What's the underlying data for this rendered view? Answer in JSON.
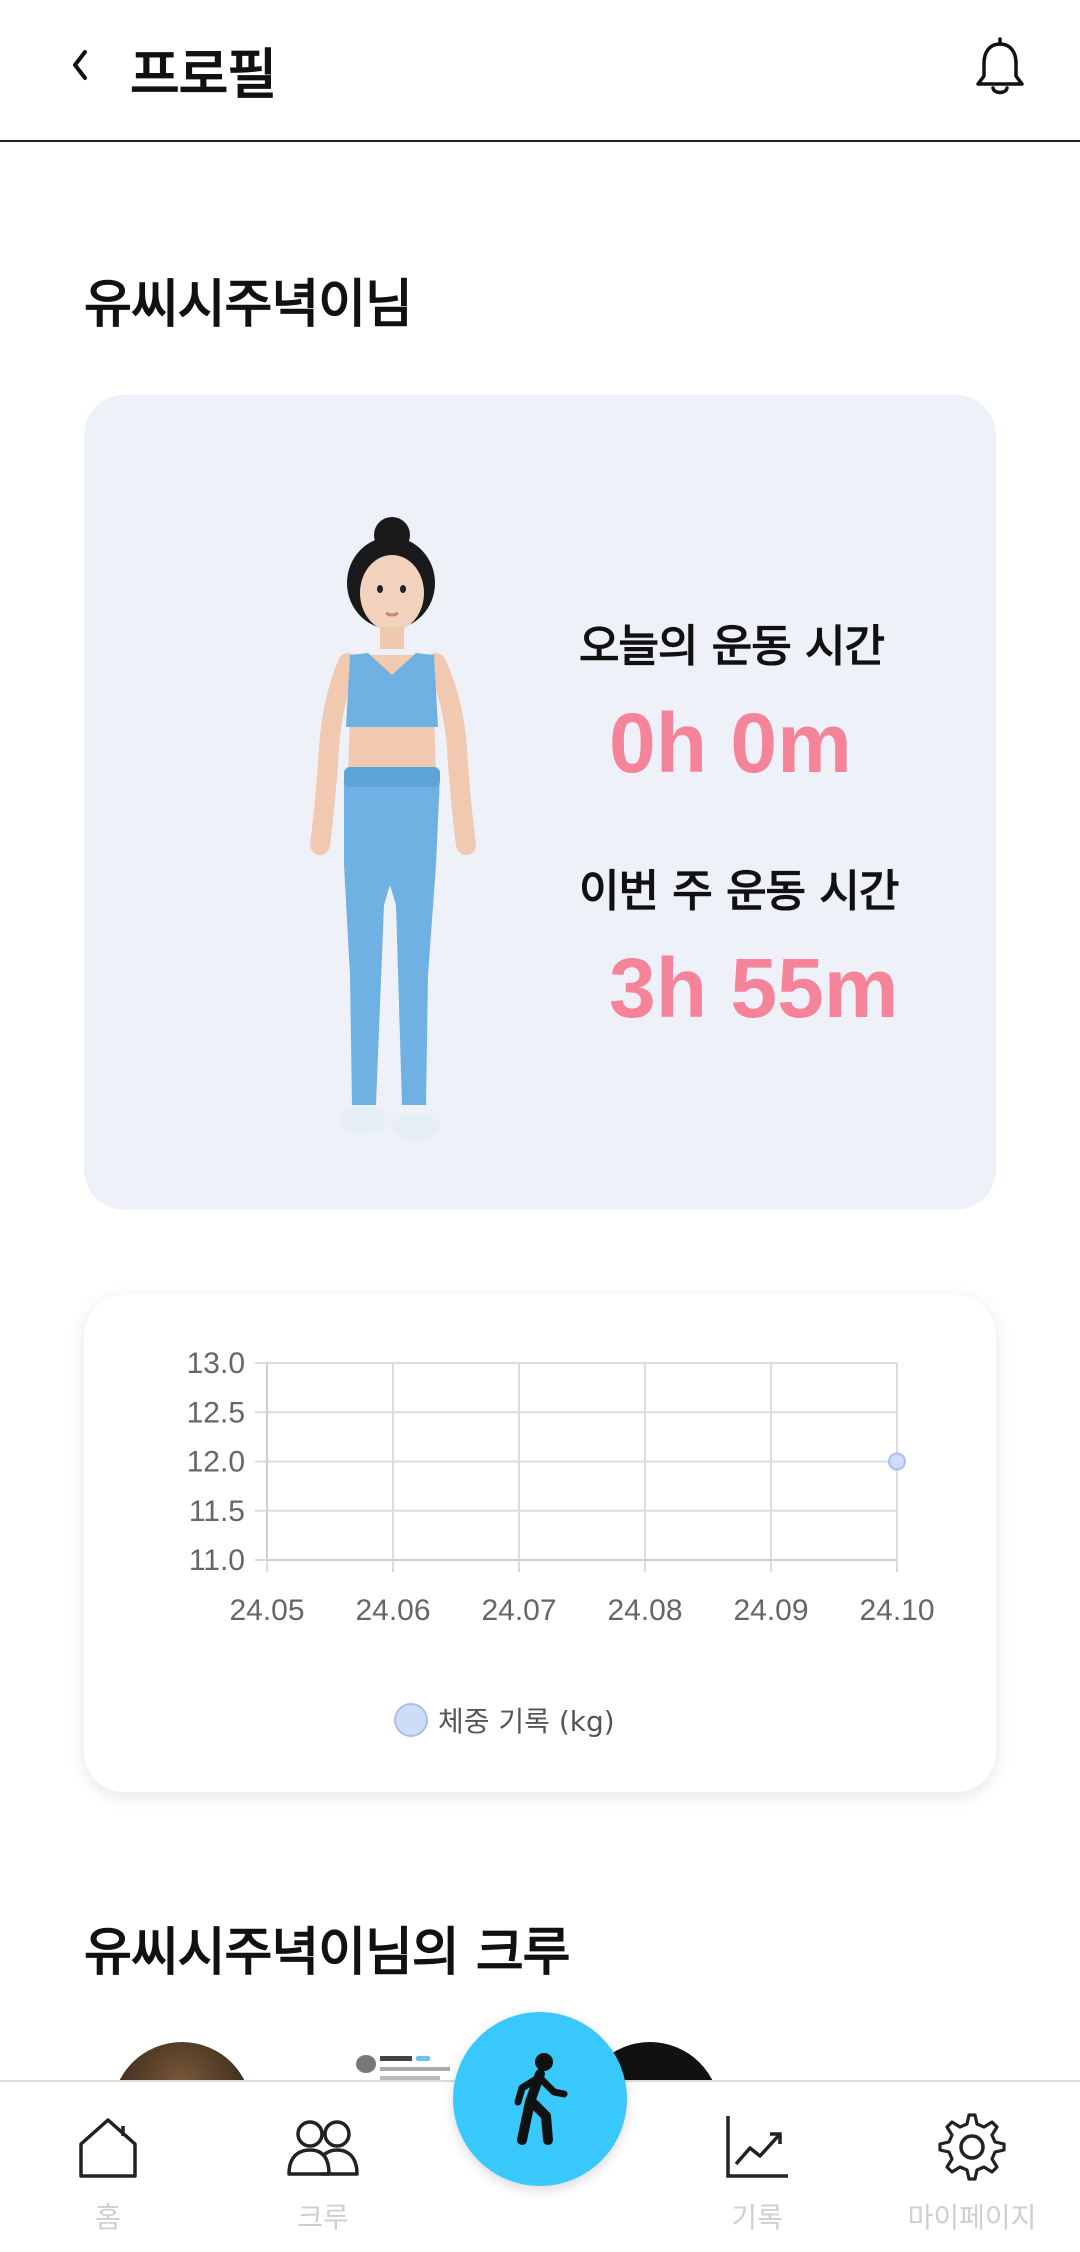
{
  "header": {
    "title": "프로필",
    "back_icon": "chevron-left-icon",
    "notification_icon": "bell-icon"
  },
  "greeting": "유씨시주녁이님",
  "profile_card": {
    "today_label": "오늘의 운동 시간",
    "today_value": "0h 0m",
    "week_label": "이번 주 운동 시간",
    "week_value": "3h 55m",
    "value_color": "#f5849a",
    "card_bg": "#eff1f8"
  },
  "chart_data": {
    "type": "line",
    "x": [
      "24.05",
      "24.06",
      "24.07",
      "24.08",
      "24.09",
      "24.10"
    ],
    "series": [
      {
        "name": "체중 기록 (kg)",
        "values": [
          null,
          null,
          null,
          null,
          null,
          12.0
        ]
      }
    ],
    "yticks": [
      "13.0",
      "12.5",
      "12.0",
      "11.5",
      "11.0"
    ],
    "ylim": [
      11.0,
      13.0
    ],
    "grid": true,
    "legend": "bottom",
    "legend_label": "체중 기록 (kg)",
    "point_color": "#cfdcf7"
  },
  "crew_section": {
    "title": "유씨시주녁이님의 크루"
  },
  "bottom_nav": {
    "items": [
      {
        "label": "홈",
        "icon": "home-icon"
      },
      {
        "label": "크루",
        "icon": "crew-icon"
      },
      {
        "label": "기록",
        "icon": "chart-line-icon"
      },
      {
        "label": "마이페이지",
        "icon": "gear-icon"
      }
    ],
    "fab_icon": "walking-person-icon",
    "fab_color": "#38c8fb"
  }
}
